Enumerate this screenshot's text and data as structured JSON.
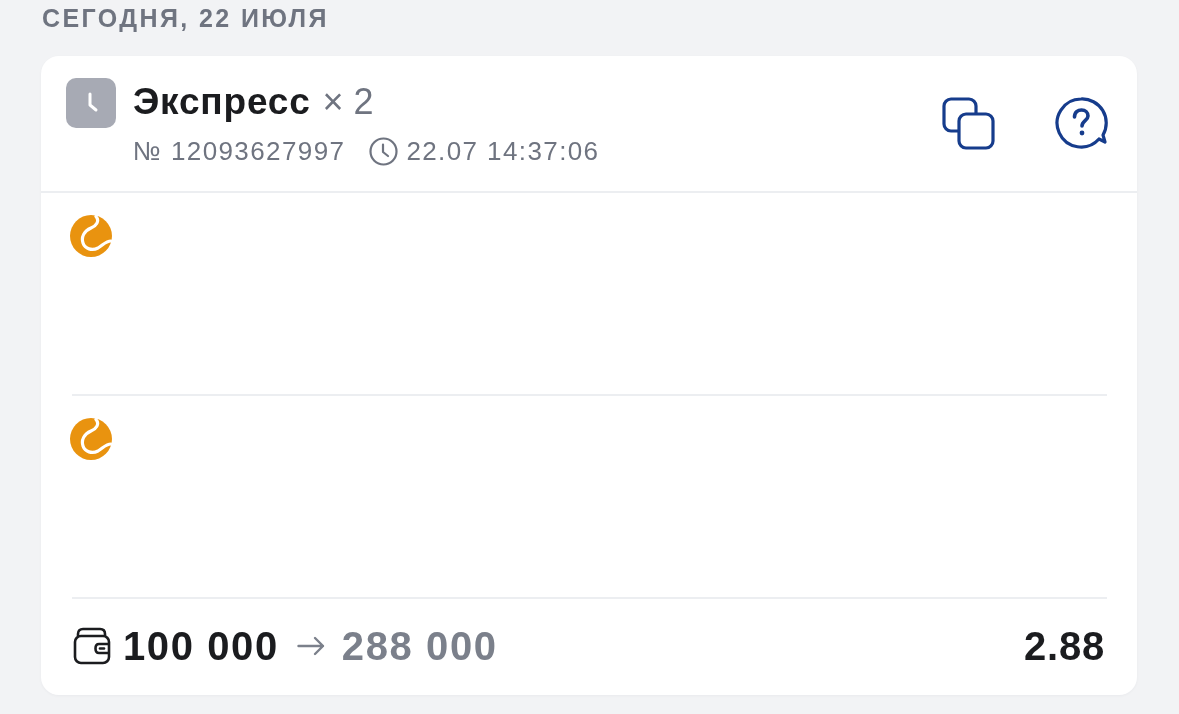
{
  "date_heading": "СЕГОДНЯ, 22 ИЮЛЯ",
  "bet_card": {
    "bet_type": "Экспресс",
    "multiplier": "× 2",
    "number": "№ 12093627997",
    "time": "22.07 14:37:06",
    "events": [
      {
        "kind": "tennis"
      },
      {
        "kind": "tennis"
      }
    ],
    "footer": {
      "stake": "100 000",
      "payout": "288 000",
      "odds": "2.88"
    }
  }
}
